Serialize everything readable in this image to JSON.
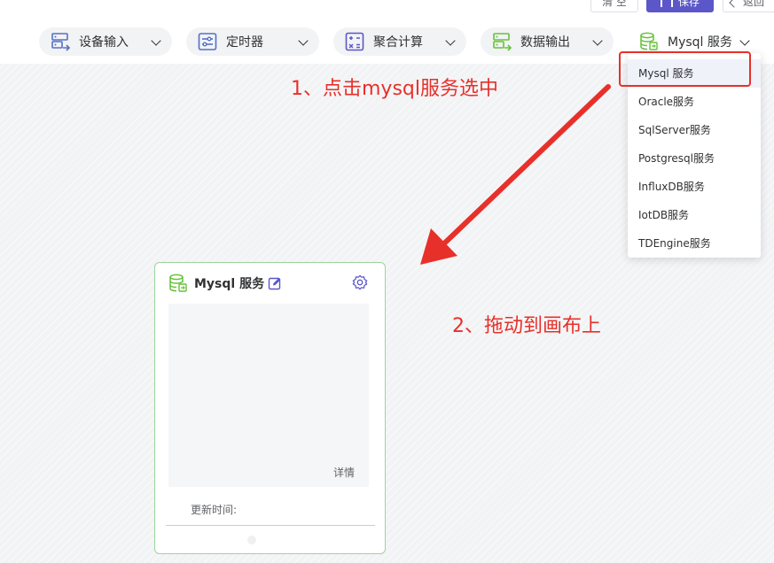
{
  "header": {
    "clear_label": "清 空",
    "save_label": "保存",
    "back_label": "返回"
  },
  "toolbar": {
    "items": [
      {
        "label": "设备输入",
        "icon": "device-input-icon"
      },
      {
        "label": "定时器",
        "icon": "timer-icon"
      },
      {
        "label": "聚合计算",
        "icon": "calculator-icon"
      },
      {
        "label": "数据输出",
        "icon": "data-output-icon"
      },
      {
        "label": "Mysql 服务",
        "icon": "database-icon"
      }
    ]
  },
  "dropdown": {
    "items": [
      "Mysql 服务",
      "Oracle服务",
      "SqlServer服务",
      "Postgresql服务",
      "InfluxDB服务",
      "IotDB服务",
      "TDEngine服务"
    ],
    "selected_index": 0
  },
  "annotations": {
    "step1": "1、点击mysql服务选中",
    "step2": "2、拖动到画布上"
  },
  "node": {
    "title": "Mysql 服务",
    "detail_label": "详情",
    "update_time_label": "更新时间:"
  },
  "colors": {
    "accent": "#5b57c9",
    "annotation": "#e8302a",
    "node_border": "#9cd39e",
    "icon_blue": "#5470c6",
    "icon_purple": "#5b57c9",
    "icon_green": "#67c23a"
  }
}
